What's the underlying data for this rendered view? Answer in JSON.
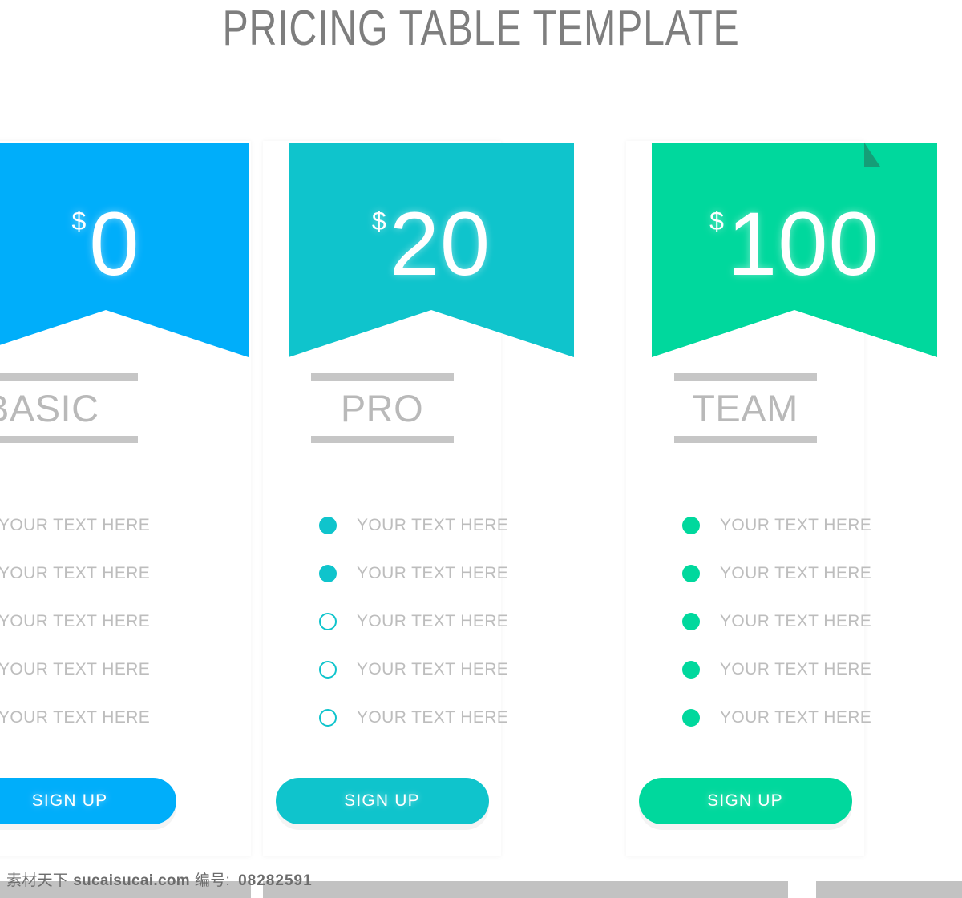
{
  "page": {
    "title": "PRICING TABLE TEMPLATE",
    "background": "#ffffff",
    "title_color": "#7e7e7e"
  },
  "plans": [
    {
      "id": "basic",
      "name": "BASIC",
      "currency": "$",
      "price": "0",
      "accent": "#00aefa",
      "signup_label": "SIGN UP",
      "features": [
        {
          "label": "YOUR TEXT HERE",
          "bullet": "none"
        },
        {
          "label": "YOUR TEXT HERE",
          "bullet": "none"
        },
        {
          "label": "YOUR TEXT HERE",
          "bullet": "none"
        },
        {
          "label": "YOUR TEXT HERE",
          "bullet": "none"
        },
        {
          "label": "YOUR TEXT HERE",
          "bullet": "none"
        }
      ]
    },
    {
      "id": "pro",
      "name": "PRO",
      "currency": "$",
      "price": "20",
      "accent": "#0fc4cc",
      "signup_label": "SIGN UP",
      "features": [
        {
          "label": "YOUR TEXT HERE",
          "bullet": "filled"
        },
        {
          "label": "YOUR TEXT HERE",
          "bullet": "filled"
        },
        {
          "label": "YOUR TEXT HERE",
          "bullet": "hollow"
        },
        {
          "label": "YOUR TEXT HERE",
          "bullet": "hollow"
        },
        {
          "label": "YOUR TEXT HERE",
          "bullet": "hollow"
        }
      ]
    },
    {
      "id": "team",
      "name": "TEAM",
      "currency": "$",
      "price": "100",
      "accent": "#00d89d",
      "fold_color": "#159e77",
      "signup_label": "SIGN UP",
      "features": [
        {
          "label": "YOUR TEXT HERE",
          "bullet": "filled"
        },
        {
          "label": "YOUR TEXT HERE",
          "bullet": "filled"
        },
        {
          "label": "YOUR TEXT HERE",
          "bullet": "filled"
        },
        {
          "label": "YOUR TEXT HERE",
          "bullet": "filled"
        },
        {
          "label": "YOUR TEXT HERE",
          "bullet": "filled"
        }
      ]
    }
  ],
  "footer": {
    "brand": "素材天下",
    "site": "sucaisucai.com",
    "id_label": "编号:",
    "id_value": "08282591"
  }
}
